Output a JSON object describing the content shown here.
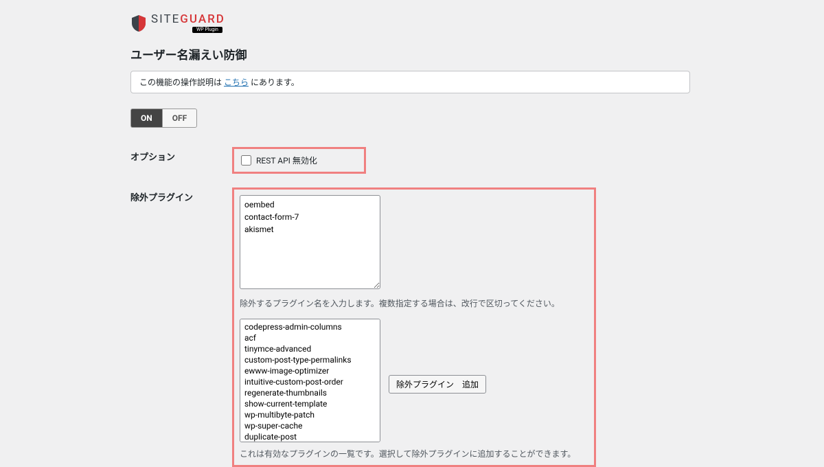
{
  "logo": {
    "site_text": "SITE",
    "guard_text": "GUARD",
    "sub_text": "WP Plugin"
  },
  "page_title": "ユーザー名漏えい防御",
  "notice": {
    "prefix": "この機能の操作説明は ",
    "link_text": "こちら",
    "suffix": " にあります。"
  },
  "toggle": {
    "on_label": "ON",
    "off_label": "OFF"
  },
  "option_section": {
    "label": "オプション",
    "checkbox_label": "REST API 無効化"
  },
  "exclude_section": {
    "label": "除外プラグイン",
    "textarea_value": "oembed\ncontact-form-7\nakismet",
    "textarea_helper": "除外するプラグイン名を入力します。複数指定する場合は、改行で区切ってください。",
    "plugin_options": [
      "codepress-admin-columns",
      "acf",
      "tinymce-advanced",
      "custom-post-type-permalinks",
      "ewww-image-optimizer",
      "intuitive-custom-post-order",
      "regenerate-thumbnails",
      "show-current-template",
      "wp-multibyte-patch",
      "wp-super-cache",
      "duplicate-post"
    ],
    "add_button_label": "除外プラグイン　追加",
    "select_helper": "これは有効なプラグインの一覧です。選択して除外プラグインに追加することができます。"
  }
}
